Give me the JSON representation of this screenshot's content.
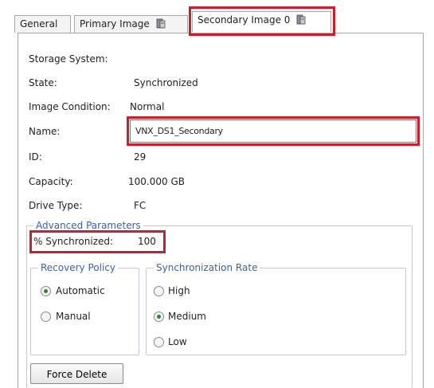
{
  "tabs": [
    {
      "label": "General"
    },
    {
      "label": "Primary Image"
    },
    {
      "label": "Secondary Image 0"
    }
  ],
  "fields": {
    "storage_system": {
      "label": "Storage System:",
      "value": ""
    },
    "state": {
      "label": "State:",
      "value": "Synchronized"
    },
    "image_condition": {
      "label": "Image Condition:",
      "value": "Normal"
    },
    "name": {
      "label": "Name:",
      "value": "VNX_DS1_Secondary"
    },
    "id": {
      "label": "ID:",
      "value": "29"
    },
    "capacity": {
      "label": "Capacity:",
      "value": "100.000 GB"
    },
    "drive_type": {
      "label": "Drive Type:",
      "value": "FC"
    }
  },
  "advanced": {
    "legend": "Advanced Parameters",
    "percent_sync_label": "% Synchronized:",
    "percent_sync_value": "100",
    "recovery_policy": {
      "legend": "Recovery Policy",
      "options": [
        "Automatic",
        "Manual"
      ],
      "selected": "Automatic"
    },
    "sync_rate": {
      "legend": "Synchronization Rate",
      "options": [
        "High",
        "Medium",
        "Low"
      ],
      "selected": "Medium"
    }
  },
  "buttons": {
    "force_delete": "Force Delete"
  },
  "colors": {
    "highlight": "#c8202a",
    "legend_text": "#3b62a8"
  },
  "icons": {
    "tab_icon": "storage-lun-icon"
  }
}
